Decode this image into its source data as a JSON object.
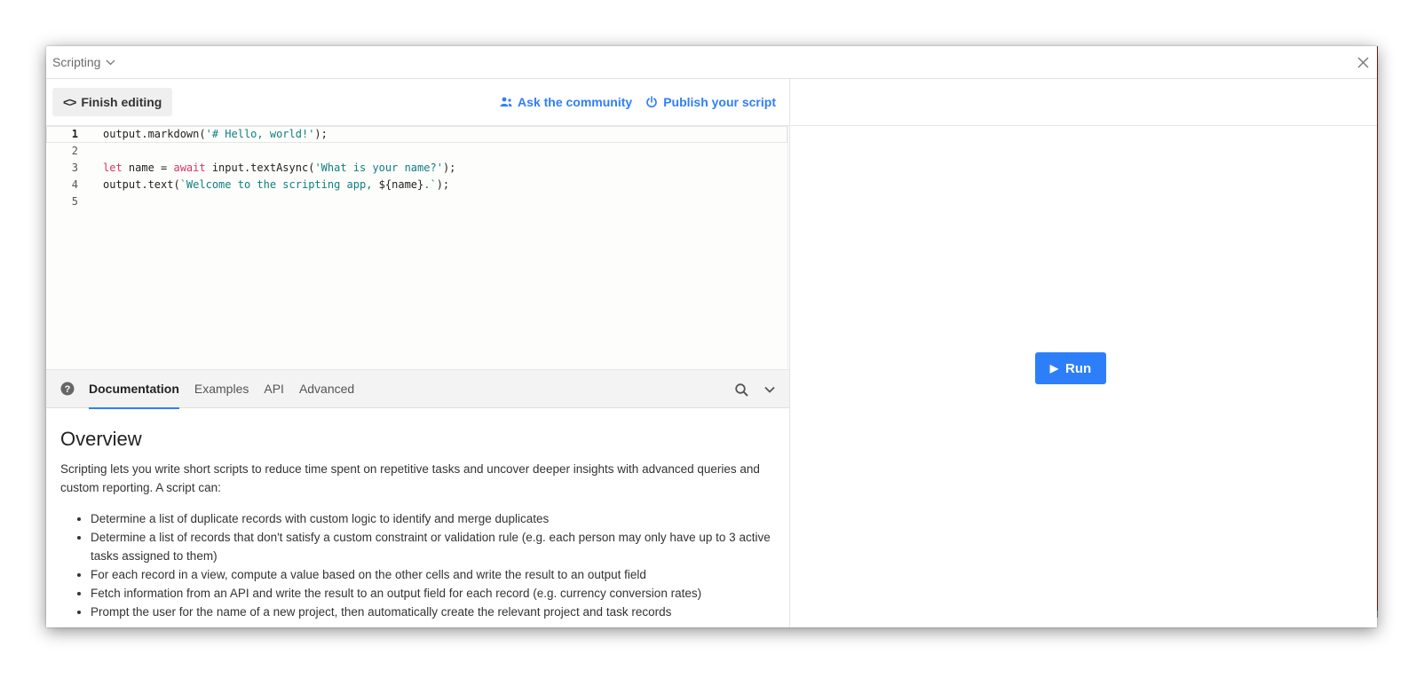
{
  "window": {
    "app_name": "Scripting"
  },
  "toolbar": {
    "finish_label": "Finish editing",
    "ask_label": "Ask the community",
    "publish_label": "Publish your script"
  },
  "editor": {
    "line_numbers": [
      "1",
      "2",
      "3",
      "4",
      "5"
    ],
    "lines": [
      "output.markdown('# Hello, world!');",
      "",
      "let name = await input.textAsync('What is your name?');",
      "output.text(`Welcome to the scripting app, ${name}.`);",
      ""
    ]
  },
  "docs_tabs": {
    "tabs": [
      "Documentation",
      "Examples",
      "API",
      "Advanced"
    ]
  },
  "docs": {
    "title": "Overview",
    "intro": "Scripting lets you write short scripts to reduce time spent on repetitive tasks and uncover deeper insights with advanced queries and custom reporting. A script can:",
    "bullets": [
      "Determine a list of duplicate records with custom logic to identify and merge duplicates",
      "Determine a list of records that don't satisfy a custom constraint or validation rule (e.g. each person may only have up to 3 active tasks assigned to them)",
      "For each record in a view, compute a value based on the other cells and write the result to an output field",
      "Fetch information from an API and write the result to an output field for each record (e.g. currency conversion rates)",
      "Prompt the user for the name of a new project, then automatically create the relevant project and task records"
    ]
  },
  "run": {
    "label": "Run"
  },
  "colors": {
    "accent": "#2d7ff9",
    "keyword": "#d6336c",
    "string": "#0f7f7f"
  }
}
